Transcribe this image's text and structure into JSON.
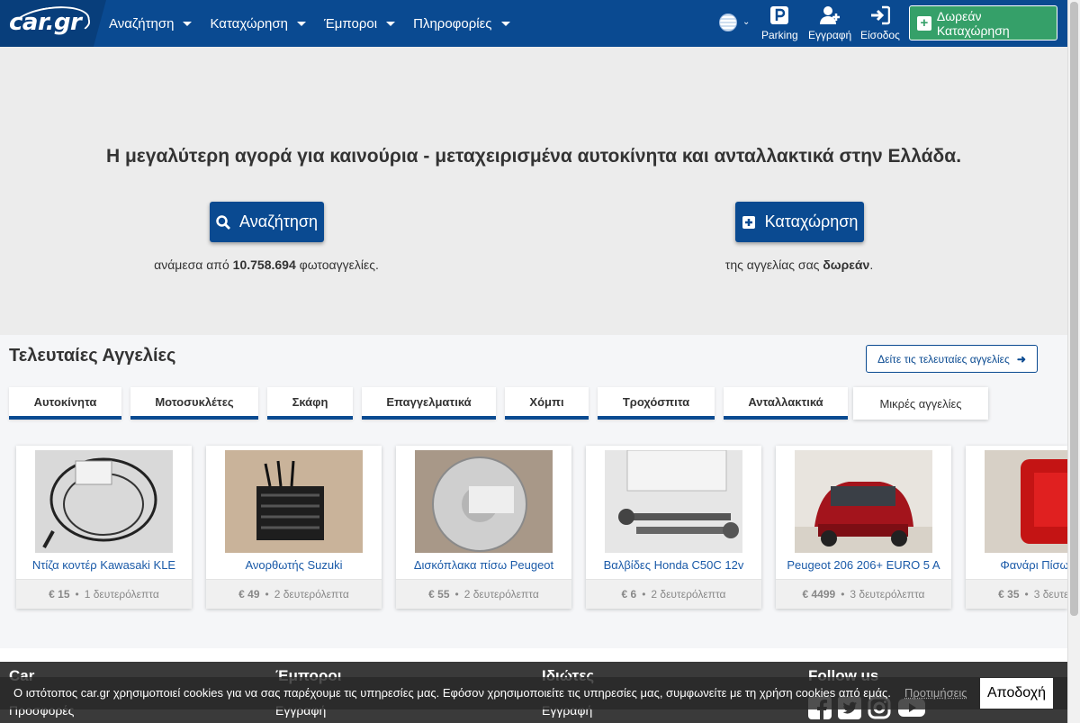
{
  "header": {
    "logo": "car.gr",
    "menu": [
      "Αναζήτηση",
      "Καταχώρηση",
      "Έμποροι",
      "Πληροφορίες"
    ],
    "parking_label": "Parking",
    "register_label": "Εγγραφή",
    "login_label": "Είσοδος",
    "free_listing_label": "Δωρεάν Καταχώρηση"
  },
  "hero": {
    "title": "Η μεγαλύτερη αγορά για καινούρια - μεταχειρισμένα αυτοκίνητα και ανταλλακτικά στην Ελλάδα.",
    "search_label": "Αναζήτηση",
    "search_sub_pre": "ανάμεσα από ",
    "search_sub_count": "10.758.694",
    "search_sub_post": " φωτοαγγελίες.",
    "list_label": "Καταχώρηση",
    "list_sub_pre": "της αγγελίας σας ",
    "list_sub_bold": "δωρεάν",
    "list_sub_post": "."
  },
  "latest": {
    "title": "Τελευταίες Αγγελίες",
    "see_latest_label": "Δείτε τις τελευταίες αγγελίες",
    "tabs": [
      "Αυτοκίνητα",
      "Μοτοσυκλέτες",
      "Σκάφη",
      "Επαγγελματικά",
      "Χόμπι",
      "Τροχόσπιτα",
      "Ανταλλακτικά",
      "Μικρές αγγελίες"
    ],
    "cards": [
      {
        "title": "Ντίζα κοντέρ Kawasaki KLE",
        "price": "€ 15",
        "time": "1 δευτερόλεπτα"
      },
      {
        "title": "Ανορθωτής Suzuki",
        "price": "€ 49",
        "time": "2 δευτερόλεπτα"
      },
      {
        "title": "Δισκόπλακα πίσω Peugeot",
        "price": "€ 55",
        "time": "2 δευτερόλεπτα"
      },
      {
        "title": "Βαλβίδες Honda C50C 12v",
        "price": "€ 6",
        "time": "2 δευτερόλεπτα"
      },
      {
        "title": "Peugeot 206 206+ EURO 5 A",
        "price": "€ 4499",
        "time": "3 δευτερόλεπτα"
      },
      {
        "title": "Φανάρι Πίσω Honda",
        "price": "€ 35",
        "time": "3 δευτερόλεπτα"
      }
    ]
  },
  "footer": {
    "cols": [
      "Car",
      "Έμποροι",
      "Ιδιώτες",
      "Follow us"
    ],
    "links": [
      "Προσφορές",
      "Εγγραφή",
      "Εγγραφή"
    ]
  },
  "cookie": {
    "text": "Ο ιστότοπος car.gr χρησιμοποιεί cookies για να σας παρέχουμε τις υπηρεσίες μας. Εφόσον χρησιμοποιείτε τις υπηρεσίες μας, συμφωνείτε με τη χρήση cookies από εμάς.",
    "preferences": "Προτιμήσεις",
    "accept": "Αποδοχή"
  },
  "colors": {
    "brand": "#0a4a91",
    "green": "#35a069"
  }
}
